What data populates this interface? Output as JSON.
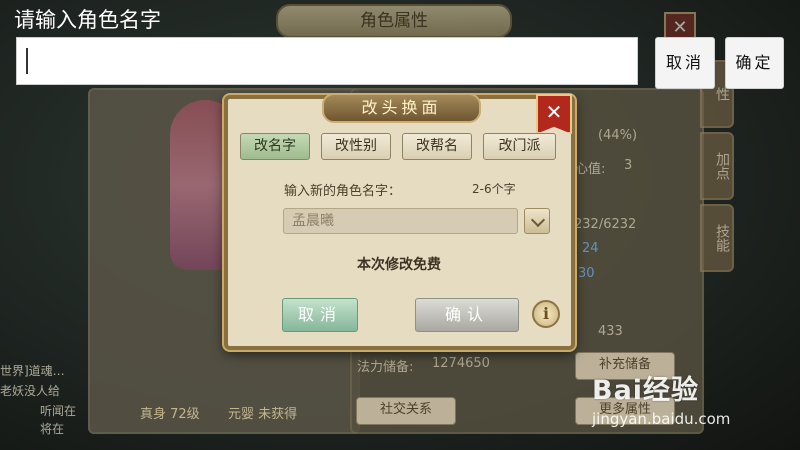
{
  "input_bar": {
    "prompt": "请输入角色名字",
    "value": "",
    "cancel_label": "取消",
    "confirm_label": "确定"
  },
  "background": {
    "panel_title": "角色属性",
    "side_tabs": [
      "性",
      "加点",
      "技能"
    ],
    "stats": [
      {
        "label": "心值:",
        "value": "3"
      },
      {
        "label": "",
        "value": "232/6232"
      },
      {
        "label": "",
        "value": "24"
      },
      {
        "label": "",
        "value": "30"
      },
      {
        "label": "",
        "value": "433"
      }
    ],
    "exp_percent": "(44%)",
    "mana_reserve_label": "法力储备:",
    "mana_reserve_value": "1274650",
    "refill_button": "补充储备",
    "social_button": "社交关系",
    "more_button": "更多属性",
    "level_badge": "真身 72级",
    "yuanying_badge": "元婴 未获得",
    "chat_lines": [
      "世界]道魂…",
      "老妖没人给",
      "听闻在",
      "将在"
    ]
  },
  "dialog": {
    "title": "改头换面",
    "tabs": [
      {
        "label": "改名字",
        "active": true
      },
      {
        "label": "改性别",
        "active": false
      },
      {
        "label": "改帮名",
        "active": false
      },
      {
        "label": "改门派",
        "active": false
      }
    ],
    "prompt": "输入新的角色名字：",
    "length_hint": "2-6个字",
    "name_value": "孟晨曦",
    "notice": "本次修改免费",
    "cancel_label": "取消",
    "confirm_label": "确认",
    "info_label": "i",
    "close_label": "✕"
  },
  "watermark": {
    "logo": "Bai经验",
    "url": "jingyan.baidu.com"
  }
}
